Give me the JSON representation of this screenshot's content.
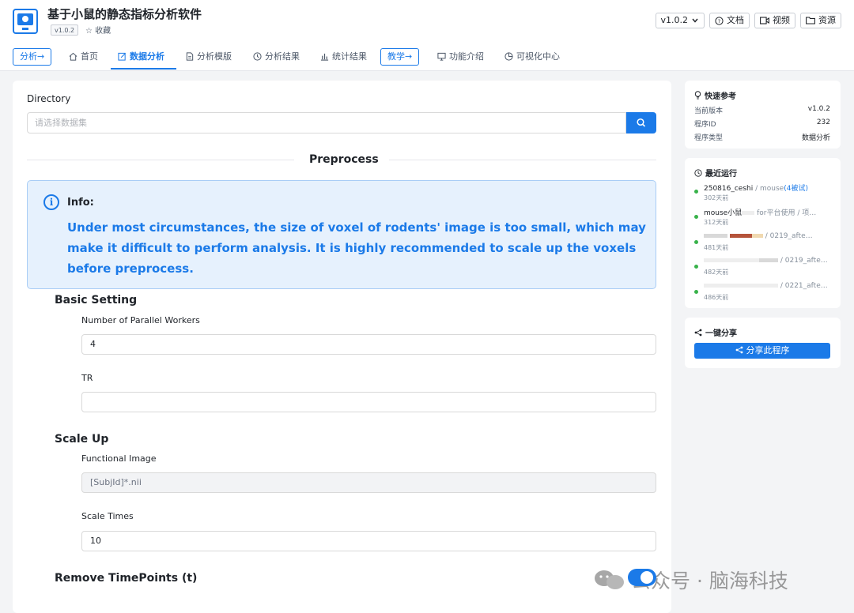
{
  "header": {
    "title": "基于小鼠的静态指标分析软件",
    "version_badge": "v1.0.2",
    "favorite": "☆ 收藏",
    "version_select": "v1.0.2",
    "docs": "文档",
    "video": "视频",
    "resources": "资源"
  },
  "nav": {
    "analysis_pill": "分析→",
    "home": "首页",
    "data_analysis": "数据分析",
    "templates": "分析模版",
    "results": "分析结果",
    "stats": "统计结果",
    "teaching_pill": "教学→",
    "features": "功能介绍",
    "viz": "可视化中心"
  },
  "main": {
    "directory_label": "Directory",
    "directory_placeholder": "请选择数据集",
    "section_title": "Preprocess",
    "info_title": "Info:",
    "info_text": "Under most circumstances, the size of voxel of rodents' image is too small, which may make it difficult to perform analysis. It is highly recommended to scale up the voxels before preprocess.",
    "basic_setting": "Basic Setting",
    "workers_label": "Number of Parallel Workers",
    "workers_value": "4",
    "tr_label": "TR",
    "tr_value": "",
    "scale_up": "Scale Up",
    "functional_label": "Functional Image",
    "functional_value": "[SubjId]*.nii",
    "scale_times_label": "Scale Times",
    "scale_times_value": "10",
    "remove_timepoints": "Remove TimePoints (t)"
  },
  "quickref": {
    "title": "快速参考",
    "rows": [
      {
        "k": "当前版本",
        "v": "v1.0.2"
      },
      {
        "k": "程序ID",
        "v": "232"
      },
      {
        "k": "程序类型",
        "v": "数据分析"
      }
    ]
  },
  "recent": {
    "title": "最近运行",
    "runs": [
      {
        "name": "250816_ceshi",
        "sub": " / mouse",
        "tag": "(4被试)",
        "time": "302天前"
      },
      {
        "name": "mouse小鼠",
        "sub": " for平台使用 / 项…",
        "tag": "",
        "time": "312天前"
      },
      {
        "name": "",
        "sub": " / 0219_afte…",
        "tag": "",
        "time": "481天前"
      },
      {
        "name": "",
        "sub": " / 0219_afte…",
        "tag": "",
        "time": "482天前"
      },
      {
        "name": "",
        "sub": " / 0221_afte…",
        "tag": "",
        "time": "486天前"
      }
    ]
  },
  "share": {
    "title": "一键分享",
    "button": "分享此程序"
  },
  "watermark": "公众号 · 脑海科技",
  "colors": {
    "accent": "#1b7ae8",
    "info_bg": "#e6f1fd",
    "status_green": "#38b24a"
  }
}
